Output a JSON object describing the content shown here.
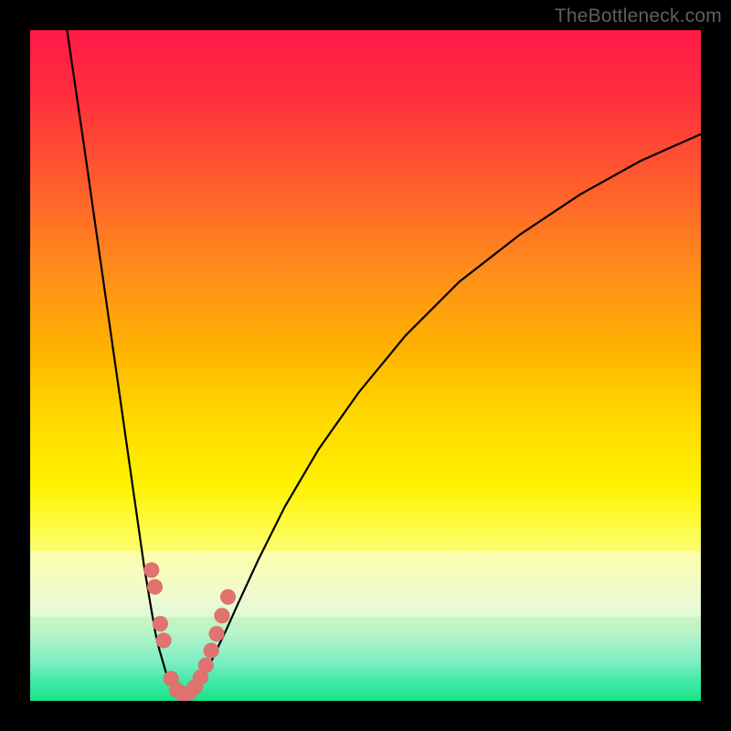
{
  "watermark": "TheBottleneck.com",
  "colors": {
    "marker": "#e0726f",
    "curve": "#000000"
  },
  "chart_data": {
    "type": "line",
    "title": "",
    "xlabel": "",
    "ylabel": "",
    "xlim": [
      0,
      100
    ],
    "ylim": [
      0,
      100
    ],
    "series": [
      {
        "name": "left-branch",
        "x": [
          5.5,
          8,
          10,
          12,
          14,
          15.5,
          17,
          18,
          18.7,
          19.3,
          19.8,
          20.2,
          20.6,
          21.0
        ],
        "y": [
          100,
          83,
          69,
          55,
          41,
          30.5,
          20,
          14,
          10,
          7.5,
          5.8,
          4.4,
          3.3,
          2.5
        ]
      },
      {
        "name": "valley-floor",
        "x": [
          21.0,
          21.6,
          22.3,
          23.0,
          23.7,
          24.4,
          25.0
        ],
        "y": [
          2.5,
          1.4,
          0.9,
          0.75,
          0.9,
          1.4,
          2.5
        ]
      },
      {
        "name": "right-branch",
        "x": [
          25.0,
          25.6,
          26.3,
          27.1,
          28.0,
          29.2,
          31,
          34,
          38,
          43,
          49,
          56,
          64,
          73,
          82,
          91,
          100
        ],
        "y": [
          2.5,
          3.4,
          4.6,
          6.1,
          8.0,
          10.5,
          14.5,
          21,
          29,
          37.5,
          46,
          54.5,
          62.5,
          69.5,
          75.5,
          80.5,
          84.5
        ]
      }
    ],
    "markers": {
      "name": "highlighted-points",
      "points": [
        {
          "x": 18.1,
          "y": 19.5
        },
        {
          "x": 18.6,
          "y": 17.0
        },
        {
          "x": 19.4,
          "y": 11.5
        },
        {
          "x": 19.9,
          "y": 9.0
        },
        {
          "x": 21.0,
          "y": 3.3
        },
        {
          "x": 21.9,
          "y": 1.6
        },
        {
          "x": 22.8,
          "y": 1.0
        },
        {
          "x": 23.7,
          "y": 1.2
        },
        {
          "x": 24.6,
          "y": 2.1
        },
        {
          "x": 25.4,
          "y": 3.5
        },
        {
          "x": 26.2,
          "y": 5.3
        },
        {
          "x": 27.0,
          "y": 7.5
        },
        {
          "x": 27.8,
          "y": 10.0
        },
        {
          "x": 28.6,
          "y": 12.7
        },
        {
          "x": 29.5,
          "y": 15.5
        }
      ],
      "radius_px": 8.5
    }
  }
}
